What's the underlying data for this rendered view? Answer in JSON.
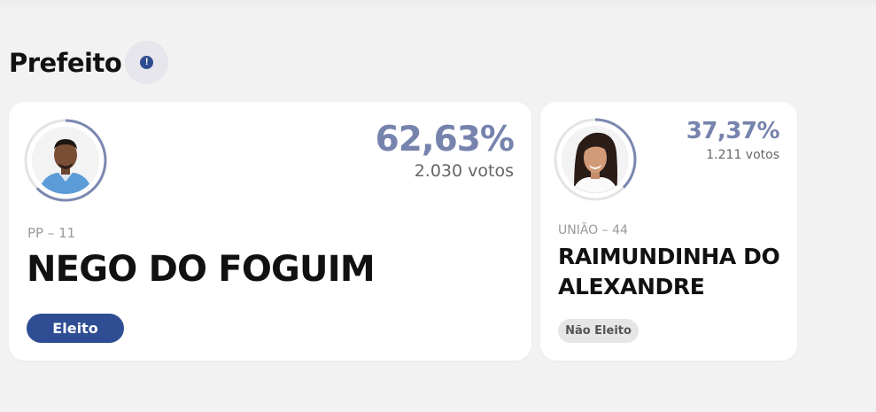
{
  "section": {
    "title": "Prefeito",
    "info_glyph": "!",
    "info_icon": "info-icon"
  },
  "colors": {
    "accent": "#2e4d93",
    "percent": "#7683ad",
    "ring": "#7c88b0",
    "ring_track": "#e4e4e4"
  },
  "candidates": [
    {
      "percent": "62,63%",
      "percent_value": 62.63,
      "votes": "2.030 votos",
      "party": "PP – 11",
      "name": "NEGO DO FOGUIM",
      "status": "Eleito",
      "elected": true
    },
    {
      "percent": "37,37%",
      "percent_value": 37.37,
      "votes": "1.211 votos",
      "party": "UNIÃO – 44",
      "name": "RAIMUNDINHA DO ALEXANDRE",
      "status": "Não Eleito",
      "elected": false
    }
  ]
}
